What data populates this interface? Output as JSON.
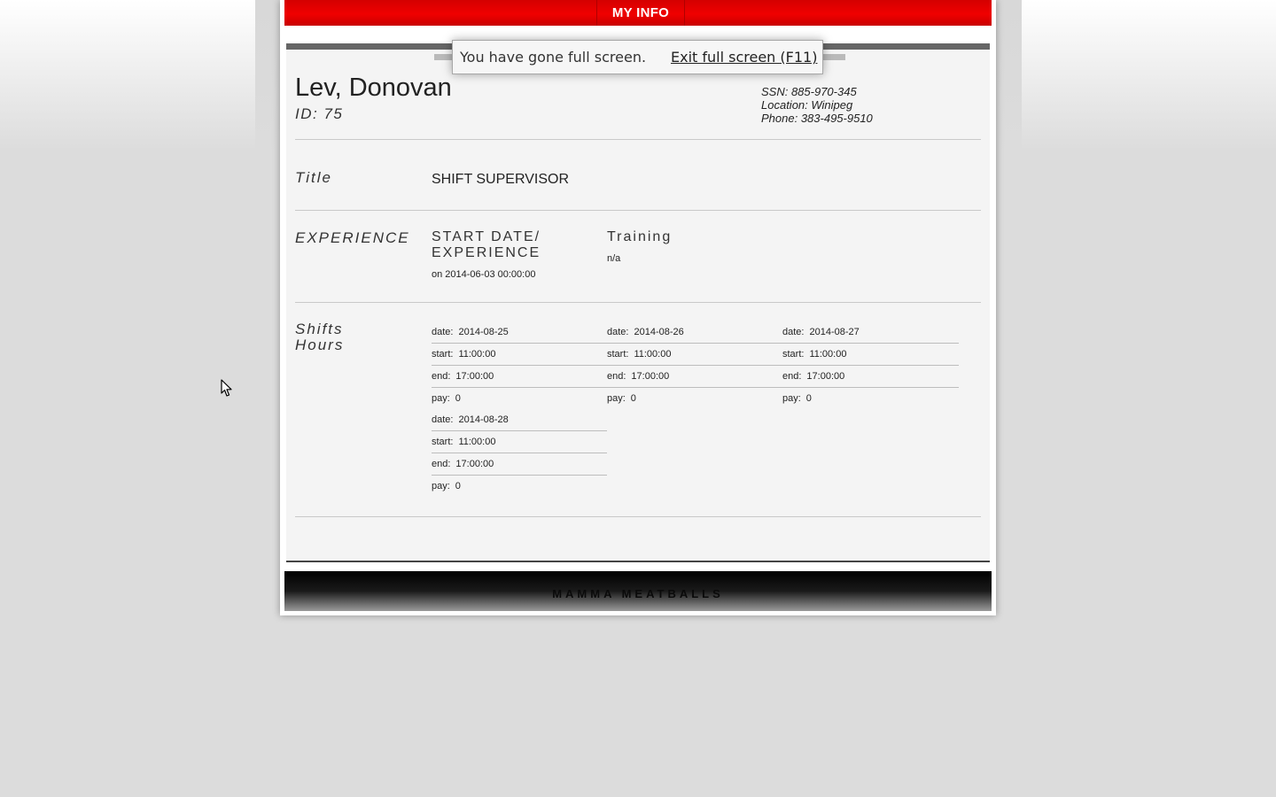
{
  "nav": {
    "my_info": "MY INFO"
  },
  "employee": {
    "name": "Lev, Donovan",
    "id_line": "ID: 75",
    "ssn": "SSN: 885-970-345",
    "location": "Location: Winipeg",
    "phone": "Phone: 383-495-9510"
  },
  "title_section": {
    "label": "Title",
    "value": "SHIFT SUPERVISOR"
  },
  "experience": {
    "label": "EXPERIENCE",
    "start_heading": "START DATE/ EXPERIENCE",
    "start_value": "on 2014-06-03 00:00:00",
    "training_heading": "Training",
    "training_value": "n/a"
  },
  "shifts": {
    "label_line1": "Shifts",
    "label_line2": "Hours",
    "labels": {
      "date": "date:",
      "start": "start:",
      "end": "end:",
      "pay": "pay:"
    },
    "items": [
      {
        "date": "2014-08-25",
        "start": "11:00:00",
        "end": "17:00:00",
        "pay": "0"
      },
      {
        "date": "2014-08-26",
        "start": "11:00:00",
        "end": "17:00:00",
        "pay": "0"
      },
      {
        "date": "2014-08-27",
        "start": "11:00:00",
        "end": "17:00:00",
        "pay": "0"
      },
      {
        "date": "2014-08-28",
        "start": "11:00:00",
        "end": "17:00:00",
        "pay": "0"
      }
    ]
  },
  "footer": {
    "brand": "MAMMA MEATBALLS"
  },
  "fullscreen_notice": {
    "message": "You have gone full screen.",
    "exit_label": "Exit full screen (F11)"
  },
  "colors": {
    "accent": "#e00000",
    "footer": "#000000",
    "panel": "#f4f4f4"
  }
}
